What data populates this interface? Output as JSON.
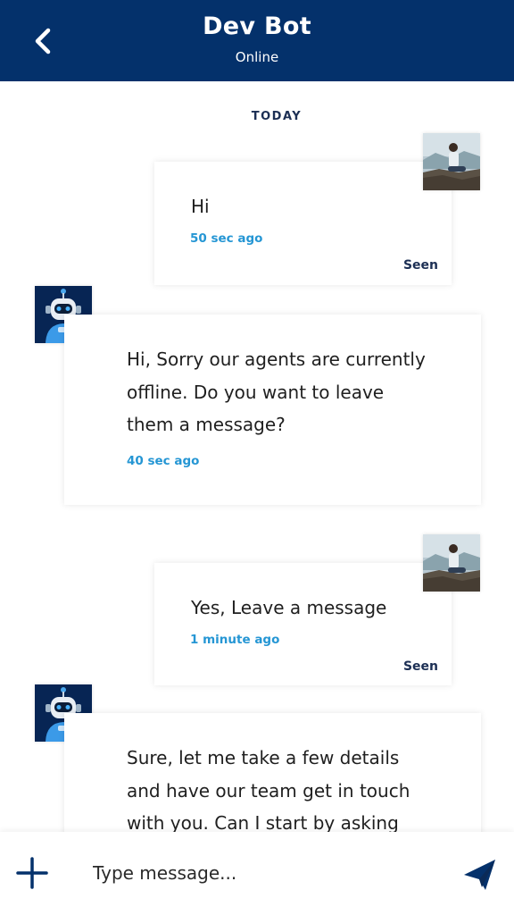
{
  "header": {
    "title": "Dev Bot",
    "status": "Online",
    "background_color": "#04316b",
    "back_icon": "chevron-left-icon"
  },
  "chat": {
    "date_separator": "TODAY",
    "messages": [
      {
        "sender": "user",
        "text_lines": [
          "Hi"
        ],
        "time": "50 sec ago",
        "seen_label": "Seen",
        "avatar": "user-photo-avatar"
      },
      {
        "sender": "bot",
        "text_lines": [
          "Hi, Sorry our agents are currently",
          "offline. Do you want to leave",
          "them a message?"
        ],
        "time": "40 sec ago",
        "avatar": "robot-avatar"
      },
      {
        "sender": "user",
        "text_lines": [
          "Yes, Leave a message"
        ],
        "time": "1 minute ago",
        "seen_label": "Seen",
        "avatar": "user-photo-avatar"
      },
      {
        "sender": "bot",
        "text_lines": [
          "Sure, let me take a few details",
          "and have our team get in touch",
          "with you. Can I start by asking"
        ],
        "avatar": "robot-avatar"
      }
    ]
  },
  "composer": {
    "placeholder": "Type message...",
    "value": "",
    "add_icon": "plus-icon",
    "send_icon": "paper-plane-icon"
  },
  "colors": {
    "primary": "#04316b",
    "timestamp": "#2596d4",
    "text": "#1f1f1f"
  }
}
